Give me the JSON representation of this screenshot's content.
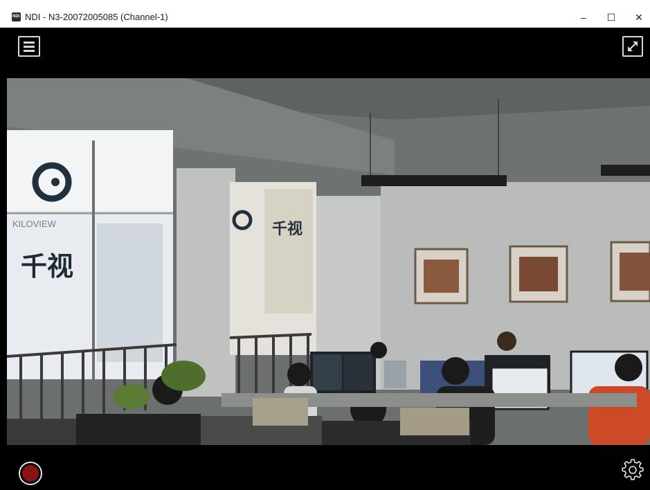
{
  "window": {
    "app_icon_text": "NDI",
    "title": "NDI - N3-20072005085 (Channel-1)",
    "controls": {
      "minimize": "–",
      "maximize": "☐",
      "close": "✕"
    }
  },
  "viewer": {
    "menu_icon": "hamburger-menu-icon",
    "fullscreen_icon": "expand-icon",
    "record_icon": "record-icon",
    "settings_icon": "gear-icon",
    "record_color": "#8b1212"
  },
  "scene": {
    "window_sign_text_1": "千视",
    "window_sign_text_2": "KILOVIEW",
    "window_sign_text_3": "千视"
  }
}
